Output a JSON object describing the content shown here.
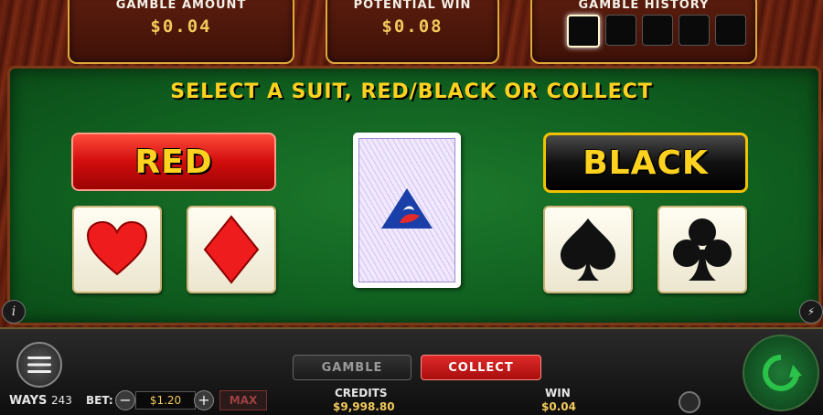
{
  "header": {
    "gamble_amount": {
      "title": "GAMBLE AMOUNT",
      "value": "$0.04"
    },
    "potential_win": {
      "title": "POTENTIAL WIN",
      "value": "$0.08"
    },
    "gamble_history": {
      "title": "GAMBLE HISTORY"
    }
  },
  "prompt": "SELECT A SUIT, RED/BLACK OR COLLECT",
  "buttons": {
    "red": "RED",
    "black": "BLACK",
    "gamble": "GAMBLE",
    "collect": "COLLECT",
    "max": "MAX"
  },
  "suits": [
    "heart",
    "diamond",
    "spade",
    "club"
  ],
  "footer": {
    "ways_label": "WAYS",
    "ways_value": "243",
    "bet_label": "BET:",
    "bet_value": "$1.20",
    "credits_label": "CREDITS",
    "credits_value": "$9,998.80",
    "win_label": "WIN",
    "win_value": "$0.04"
  },
  "colors": {
    "accent": "#ffd21f",
    "red": "#d10d0d",
    "table": "#106020",
    "collect": "#c8161c"
  }
}
